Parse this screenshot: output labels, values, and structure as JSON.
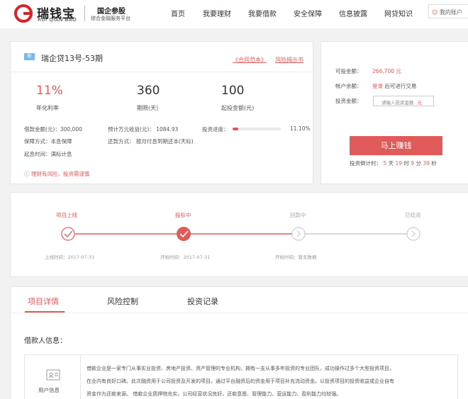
{
  "header": {
    "logo_cn": "瑞钱宝",
    "logo_en": "RUI QIAN BAO",
    "tagline": "国企参股",
    "tagline_sub": "综合金融服务平台",
    "nav": [
      "首页",
      "我要理财",
      "我要借款",
      "安全保障",
      "信息披露",
      "网贷知识"
    ],
    "account": "我的账户"
  },
  "loan": {
    "badge": "新",
    "title": "瑞企贷13号-53期",
    "contract_link": "《合同范本》",
    "risk_link": "风险揭示书",
    "rate": "11%",
    "rate_label": "年化利率",
    "term": "360",
    "term_label": "期限(天)",
    "min": "100",
    "min_label": "起投金额(元)",
    "amount": "借款金额(元)：300,000",
    "profit": "预计万元收益(元)： 1084.93",
    "progress_label": "投资进度：",
    "progress_value": 0.111,
    "progress_text": "11.10%",
    "guarantee": "保障方式：本息保障",
    "repay": "还款方式： 按月付息到期还本(天标)",
    "interest_start": "起息时间：满标计息",
    "risk_note": "理财有风险，投资需谨慎"
  },
  "invest": {
    "available_label": "可投金额：",
    "available_value": "266,700 元",
    "balance_label": "帐户余额：",
    "login": "登录",
    "login_suffix": "后可进行交易",
    "amount_label": "投资金额：",
    "input_placeholder": "请输入投资金额",
    "input_unit": "元",
    "buy_button": "马上赚钱",
    "countdown_label": "投资倒计时：",
    "cd_days": "5",
    "cd_days_unit": "天",
    "cd_hours": "19",
    "cd_hours_unit": "时",
    "cd_mins": "9",
    "cd_mins_unit": "分",
    "cd_secs": "39",
    "cd_secs_unit": "秒"
  },
  "steps": [
    {
      "label": "项目上线",
      "time": "上线时间：2017-07-31",
      "state": "done"
    },
    {
      "label": "投标中",
      "time": "开始时间：2017-07-31",
      "state": "current"
    },
    {
      "label": "回款中",
      "time": "开始时间：暂无数据",
      "state": "pending"
    },
    {
      "label": "已结清",
      "time": "",
      "state": "pending"
    }
  ],
  "colors": {
    "accent": "#e05a5a",
    "badge": "#7cb9e8",
    "pending": "#cccccc"
  },
  "tabs": [
    "项目详情",
    "风险控制",
    "投资记录"
  ],
  "borrower": {
    "heading": "借款人信息：",
    "box_label": "用户信息",
    "line1": "借款企业是一家专门从事实业投资、房地产投资、资产管理的专业机构，拥有一支从事多年投资的专业团队，成功操作过多个大型投资项目，",
    "line2": "在业内有良好口碑。此次融资用于公司投资及开发的项目。通过平台融资后的资金用于项目补充流动资金。以投资项目的投资收益或企业自有",
    "line3": "资金作为还款来源。 借款企业质押物充实，公司经营状况良好，还款意愿、管理能力、营运能力、盈利能力均较强。"
  }
}
